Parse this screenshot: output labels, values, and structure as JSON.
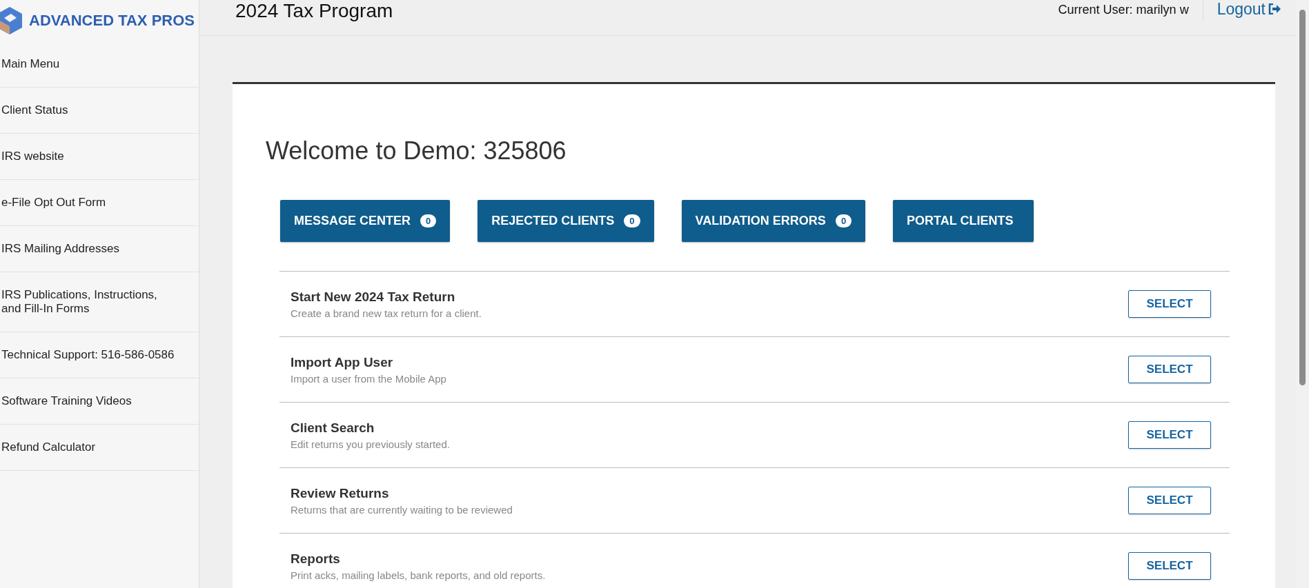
{
  "logo": {
    "text": "ADVANCED TAX PROS"
  },
  "sidebar": {
    "items": [
      {
        "label": "Main Menu"
      },
      {
        "label": "Client Status"
      },
      {
        "label": "IRS website"
      },
      {
        "label": "e-File Opt Out Form"
      },
      {
        "label": "IRS Mailing Addresses"
      },
      {
        "label": "IRS Publications, Instructions, and Fill-In Forms"
      },
      {
        "label": "Technical Support: 516-586-0586"
      },
      {
        "label": "Software Training Videos"
      },
      {
        "label": "Refund Calculator"
      }
    ]
  },
  "header": {
    "title": "2024 Tax Program",
    "current_user": "Current User: marilyn w",
    "logout": "Logout"
  },
  "welcome": "Welcome to Demo: 325806",
  "quick_buttons": [
    {
      "label": "MESSAGE CENTER",
      "count": "0"
    },
    {
      "label": "REJECTED CLIENTS",
      "count": "0"
    },
    {
      "label": "VALIDATION ERRORS",
      "count": "0"
    },
    {
      "label": "PORTAL CLIENTS"
    }
  ],
  "menu": [
    {
      "title": "Start New 2024 Tax Return",
      "description": "Create a brand new tax return for a client.",
      "button": "SELECT"
    },
    {
      "title": "Import App User",
      "description": "Import a user from the Mobile App",
      "button": "SELECT"
    },
    {
      "title": "Client Search",
      "description": "Edit returns you previously started.",
      "button": "SELECT"
    },
    {
      "title": "Review Returns",
      "description": "Returns that are currently waiting to be reviewed",
      "button": "SELECT"
    },
    {
      "title": "Reports",
      "description": "Print acks, mailing labels, bank reports, and old reports.",
      "button": "SELECT"
    }
  ]
}
